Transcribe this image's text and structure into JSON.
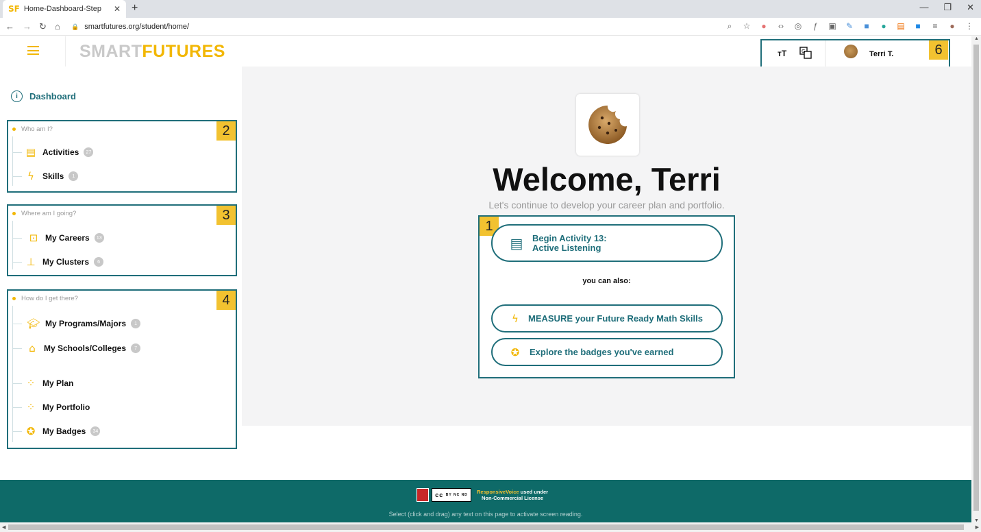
{
  "browser": {
    "tab_title": "Home-Dashboard-Step",
    "tab_favicon": "SF",
    "url": "smartfutures.org/student/home/"
  },
  "header": {
    "logo_smart": "SMART",
    "logo_futures": "FUTURES",
    "text_size_label": "тT",
    "user_name": "Terri T.",
    "toolbox_marker": "6"
  },
  "sidebar": {
    "dashboard_label": "Dashboard",
    "groups": [
      {
        "marker": "2",
        "title": "Who am I?",
        "items": [
          {
            "label": "Activities",
            "count": "27",
            "icon": "activities-icon"
          },
          {
            "label": "Skills",
            "count": "1",
            "icon": "lightning-icon"
          }
        ]
      },
      {
        "marker": "3",
        "title": "Where am I going?",
        "items": [
          {
            "label": "My Careers",
            "count": "13",
            "icon": "briefcase-icon"
          },
          {
            "label": "My Clusters",
            "count": "6",
            "icon": "org-chart-icon"
          }
        ]
      },
      {
        "marker": "4",
        "title": "How do I get there?",
        "items": [
          {
            "label": "My Programs/Majors",
            "count": "1",
            "icon": "graduation-cap-icon"
          },
          {
            "label": "My Schools/Colleges",
            "count": "7",
            "icon": "school-building-icon"
          },
          {
            "label": "My Plan",
            "count": "",
            "icon": "plan-path-icon"
          },
          {
            "label": "My Portfolio",
            "count": "",
            "icon": "portfolio-path-icon"
          },
          {
            "label": "My Badges",
            "count": "34",
            "icon": "badge-icon"
          }
        ]
      }
    ]
  },
  "main": {
    "welcome": "Welcome, Terri",
    "subtitle": "Let's continue to develop your career plan and portfolio.",
    "cta_marker": "1",
    "primary_line1": "Begin Activity 13:",
    "primary_line2": "Active Listening",
    "also_label": "you can also:",
    "measure_label": "MEASURE your Future Ready Math Skills",
    "badges_label": "Explore the badges you've earned"
  },
  "footer": {
    "cc_label": "cc",
    "cc_terms": "BY NC ND",
    "rv_name": "ResponsiveVoice",
    "rv_used": " used under",
    "rv_license": "Non-Commercial License",
    "note": "Select (click and drag) any text on this page to activate screen reading."
  },
  "colors": {
    "teal": "#1f6e7a",
    "yellow": "#f2b705",
    "footer": "#0e6a68",
    "marker": "#f2c230"
  }
}
